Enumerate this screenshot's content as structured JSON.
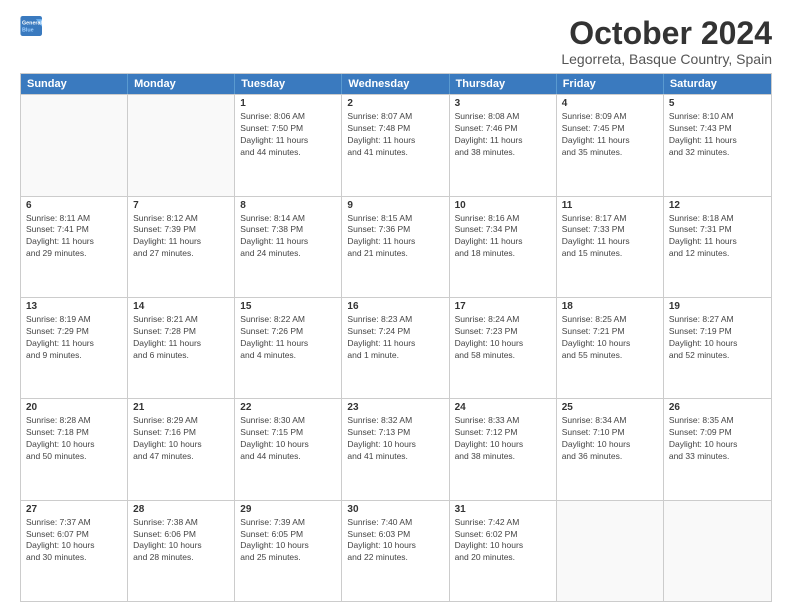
{
  "logo": {
    "line1": "General",
    "line2": "Blue"
  },
  "title": "October 2024",
  "subtitle": "Legorreta, Basque Country, Spain",
  "days": [
    "Sunday",
    "Monday",
    "Tuesday",
    "Wednesday",
    "Thursday",
    "Friday",
    "Saturday"
  ],
  "weeks": [
    [
      {
        "day": "",
        "sunrise": "",
        "sunset": "",
        "daylight": ""
      },
      {
        "day": "",
        "sunrise": "",
        "sunset": "",
        "daylight": ""
      },
      {
        "day": "1",
        "sunrise": "Sunrise: 8:06 AM",
        "sunset": "Sunset: 7:50 PM",
        "daylight": "Daylight: 11 hours and 44 minutes."
      },
      {
        "day": "2",
        "sunrise": "Sunrise: 8:07 AM",
        "sunset": "Sunset: 7:48 PM",
        "daylight": "Daylight: 11 hours and 41 minutes."
      },
      {
        "day": "3",
        "sunrise": "Sunrise: 8:08 AM",
        "sunset": "Sunset: 7:46 PM",
        "daylight": "Daylight: 11 hours and 38 minutes."
      },
      {
        "day": "4",
        "sunrise": "Sunrise: 8:09 AM",
        "sunset": "Sunset: 7:45 PM",
        "daylight": "Daylight: 11 hours and 35 minutes."
      },
      {
        "day": "5",
        "sunrise": "Sunrise: 8:10 AM",
        "sunset": "Sunset: 7:43 PM",
        "daylight": "Daylight: 11 hours and 32 minutes."
      }
    ],
    [
      {
        "day": "6",
        "sunrise": "Sunrise: 8:11 AM",
        "sunset": "Sunset: 7:41 PM",
        "daylight": "Daylight: 11 hours and 29 minutes."
      },
      {
        "day": "7",
        "sunrise": "Sunrise: 8:12 AM",
        "sunset": "Sunset: 7:39 PM",
        "daylight": "Daylight: 11 hours and 27 minutes."
      },
      {
        "day": "8",
        "sunrise": "Sunrise: 8:14 AM",
        "sunset": "Sunset: 7:38 PM",
        "daylight": "Daylight: 11 hours and 24 minutes."
      },
      {
        "day": "9",
        "sunrise": "Sunrise: 8:15 AM",
        "sunset": "Sunset: 7:36 PM",
        "daylight": "Daylight: 11 hours and 21 minutes."
      },
      {
        "day": "10",
        "sunrise": "Sunrise: 8:16 AM",
        "sunset": "Sunset: 7:34 PM",
        "daylight": "Daylight: 11 hours and 18 minutes."
      },
      {
        "day": "11",
        "sunrise": "Sunrise: 8:17 AM",
        "sunset": "Sunset: 7:33 PM",
        "daylight": "Daylight: 11 hours and 15 minutes."
      },
      {
        "day": "12",
        "sunrise": "Sunrise: 8:18 AM",
        "sunset": "Sunset: 7:31 PM",
        "daylight": "Daylight: 11 hours and 12 minutes."
      }
    ],
    [
      {
        "day": "13",
        "sunrise": "Sunrise: 8:19 AM",
        "sunset": "Sunset: 7:29 PM",
        "daylight": "Daylight: 11 hours and 9 minutes."
      },
      {
        "day": "14",
        "sunrise": "Sunrise: 8:21 AM",
        "sunset": "Sunset: 7:28 PM",
        "daylight": "Daylight: 11 hours and 6 minutes."
      },
      {
        "day": "15",
        "sunrise": "Sunrise: 8:22 AM",
        "sunset": "Sunset: 7:26 PM",
        "daylight": "Daylight: 11 hours and 4 minutes."
      },
      {
        "day": "16",
        "sunrise": "Sunrise: 8:23 AM",
        "sunset": "Sunset: 7:24 PM",
        "daylight": "Daylight: 11 hours and 1 minute."
      },
      {
        "day": "17",
        "sunrise": "Sunrise: 8:24 AM",
        "sunset": "Sunset: 7:23 PM",
        "daylight": "Daylight: 10 hours and 58 minutes."
      },
      {
        "day": "18",
        "sunrise": "Sunrise: 8:25 AM",
        "sunset": "Sunset: 7:21 PM",
        "daylight": "Daylight: 10 hours and 55 minutes."
      },
      {
        "day": "19",
        "sunrise": "Sunrise: 8:27 AM",
        "sunset": "Sunset: 7:19 PM",
        "daylight": "Daylight: 10 hours and 52 minutes."
      }
    ],
    [
      {
        "day": "20",
        "sunrise": "Sunrise: 8:28 AM",
        "sunset": "Sunset: 7:18 PM",
        "daylight": "Daylight: 10 hours and 50 minutes."
      },
      {
        "day": "21",
        "sunrise": "Sunrise: 8:29 AM",
        "sunset": "Sunset: 7:16 PM",
        "daylight": "Daylight: 10 hours and 47 minutes."
      },
      {
        "day": "22",
        "sunrise": "Sunrise: 8:30 AM",
        "sunset": "Sunset: 7:15 PM",
        "daylight": "Daylight: 10 hours and 44 minutes."
      },
      {
        "day": "23",
        "sunrise": "Sunrise: 8:32 AM",
        "sunset": "Sunset: 7:13 PM",
        "daylight": "Daylight: 10 hours and 41 minutes."
      },
      {
        "day": "24",
        "sunrise": "Sunrise: 8:33 AM",
        "sunset": "Sunset: 7:12 PM",
        "daylight": "Daylight: 10 hours and 38 minutes."
      },
      {
        "day": "25",
        "sunrise": "Sunrise: 8:34 AM",
        "sunset": "Sunset: 7:10 PM",
        "daylight": "Daylight: 10 hours and 36 minutes."
      },
      {
        "day": "26",
        "sunrise": "Sunrise: 8:35 AM",
        "sunset": "Sunset: 7:09 PM",
        "daylight": "Daylight: 10 hours and 33 minutes."
      }
    ],
    [
      {
        "day": "27",
        "sunrise": "Sunrise: 7:37 AM",
        "sunset": "Sunset: 6:07 PM",
        "daylight": "Daylight: 10 hours and 30 minutes."
      },
      {
        "day": "28",
        "sunrise": "Sunrise: 7:38 AM",
        "sunset": "Sunset: 6:06 PM",
        "daylight": "Daylight: 10 hours and 28 minutes."
      },
      {
        "day": "29",
        "sunrise": "Sunrise: 7:39 AM",
        "sunset": "Sunset: 6:05 PM",
        "daylight": "Daylight: 10 hours and 25 minutes."
      },
      {
        "day": "30",
        "sunrise": "Sunrise: 7:40 AM",
        "sunset": "Sunset: 6:03 PM",
        "daylight": "Daylight: 10 hours and 22 minutes."
      },
      {
        "day": "31",
        "sunrise": "Sunrise: 7:42 AM",
        "sunset": "Sunset: 6:02 PM",
        "daylight": "Daylight: 10 hours and 20 minutes."
      },
      {
        "day": "",
        "sunrise": "",
        "sunset": "",
        "daylight": ""
      },
      {
        "day": "",
        "sunrise": "",
        "sunset": "",
        "daylight": ""
      }
    ]
  ]
}
